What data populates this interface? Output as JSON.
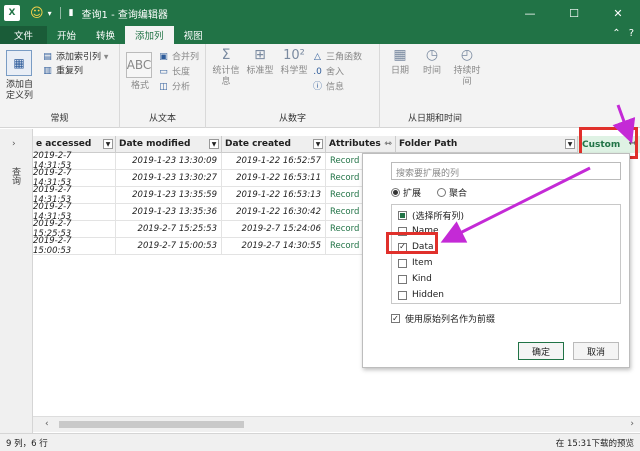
{
  "titlebar": {
    "app_icon": "X",
    "title": "查询1 - 查询编辑器",
    "minimize": "—",
    "maximize": "☐",
    "close": "✕"
  },
  "tabs": [
    {
      "label": "文件"
    },
    {
      "label": "开始"
    },
    {
      "label": "转换"
    },
    {
      "label": "添加列"
    },
    {
      "label": "视图"
    }
  ],
  "ribbon": {
    "general": {
      "label": "常规",
      "add_custom_col": "添加自定义列",
      "add_index_col": "添加索引列",
      "duplicate_col": "重复列"
    },
    "from_text": {
      "label": "从文本",
      "format": "格式",
      "merge_cols": "合并列",
      "length": "长度",
      "parse": "分析"
    },
    "from_number": {
      "label": "从数字",
      "statistics": "统计信息",
      "standard": "标准型",
      "scientific": "科学型",
      "trig": "三角函数",
      "rounding": "舍入",
      "info": "信息"
    },
    "from_datetime": {
      "label": "从日期和时间",
      "date": "日期",
      "time": "时间",
      "duration": "持续时间"
    }
  },
  "nav": {
    "queries_label": "查询"
  },
  "grid": {
    "columns": [
      {
        "label": "e accessed"
      },
      {
        "label": "Date modified"
      },
      {
        "label": "Date created"
      },
      {
        "label": "Attributes"
      },
      {
        "label": "Folder Path"
      },
      {
        "label": "Custom"
      }
    ],
    "rows": [
      [
        "2019-2-7 14:31:53",
        "2019-1-23 13:30:09",
        "2019-1-22 16:52:57",
        "Record"
      ],
      [
        "2019-2-7 14:31:53",
        "2019-1-23 13:30:27",
        "2019-1-22 16:53:11",
        "Record"
      ],
      [
        "2019-2-7 14:31:53",
        "2019-1-23 13:35:59",
        "2019-1-22 16:53:13",
        "Record"
      ],
      [
        "2019-2-7 14:31:53",
        "2019-1-23 13:35:36",
        "2019-1-22 16:30:42",
        "Record"
      ],
      [
        "2019-2-7 15:25:53",
        "2019-2-7 15:25:53",
        "2019-2-7 15:24:06",
        "Record"
      ],
      [
        "2019-2-7 15:00:53",
        "2019-2-7 15:00:53",
        "2019-2-7 14:30:55",
        "Record"
      ]
    ]
  },
  "popup": {
    "search_placeholder": "搜索要扩展的列",
    "expand": "扩展",
    "aggregate": "聚合",
    "items": [
      {
        "label": "(选择所有列)",
        "state": "partial"
      },
      {
        "label": "Name",
        "state": "unchecked"
      },
      {
        "label": "Data",
        "state": "checked"
      },
      {
        "label": "Item",
        "state": "unchecked"
      },
      {
        "label": "Kind",
        "state": "unchecked"
      },
      {
        "label": "Hidden",
        "state": "unchecked"
      }
    ],
    "use_prefix": "使用原始列名作为前缀",
    "ok": "确定",
    "cancel": "取消"
  },
  "status": {
    "left": "9 列，6 行",
    "right": "在 15:31下载的预览"
  },
  "colors": {
    "brand": "#217346",
    "highlight": "#e0302b",
    "arrow": "#c42ad6"
  }
}
